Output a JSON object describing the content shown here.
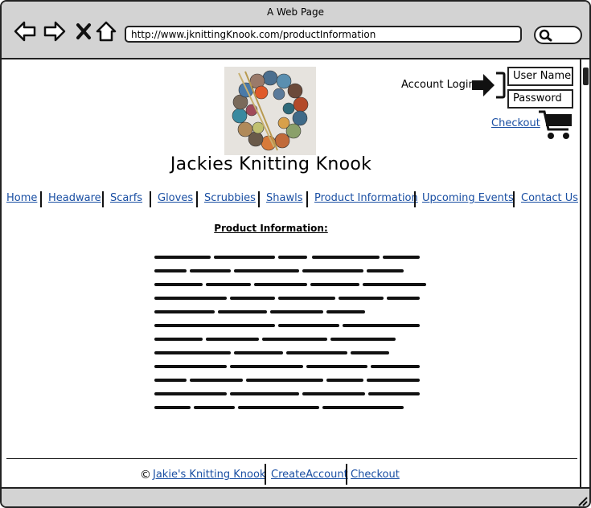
{
  "window": {
    "title": "A Web Page"
  },
  "browser": {
    "url": "http://www.jknittingKnook.com/productInformation"
  },
  "header": {
    "site_title": "Jackies Knitting Knook",
    "login_label": "Account Login",
    "username_placeholder": "User Name",
    "password_placeholder": "Password",
    "checkout_label": "Checkout"
  },
  "nav": {
    "items": [
      {
        "label": "Home"
      },
      {
        "label": "Headware"
      },
      {
        "label": "Scarfs"
      },
      {
        "label": "Gloves"
      },
      {
        "label": "Scrubbies"
      },
      {
        "label": "Shawls"
      },
      {
        "label": "Product Information"
      },
      {
        "label": "Upcoming Events"
      },
      {
        "label": "Contact Us"
      }
    ]
  },
  "main": {
    "section_title": "Product Information:"
  },
  "footer": {
    "copyright_symbol": "©",
    "links": [
      {
        "label": "Jakie's Knitting Knook"
      },
      {
        "label": "CreateAccount"
      },
      {
        "label": "Checkout"
      }
    ]
  },
  "icons": {
    "back": "arrow-left-icon",
    "forward": "arrow-right-icon",
    "stop": "close-icon",
    "home": "home-icon",
    "search": "search-icon",
    "login": "login-arrow-icon",
    "cart": "shopping-cart-icon"
  },
  "colors": {
    "link": "#1a4fa3",
    "chrome": "#d3d3d3"
  }
}
